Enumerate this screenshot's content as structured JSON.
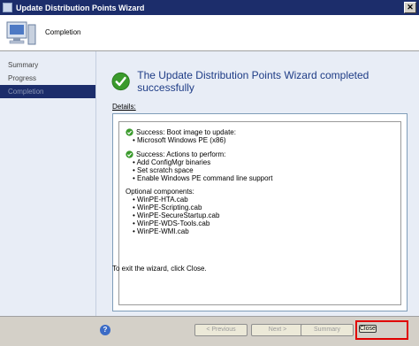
{
  "window": {
    "title": "Update Distribution Points Wizard",
    "close_glyph": "✕"
  },
  "header": {
    "title": "Completion",
    "icon": "computer-icon"
  },
  "sidebar": {
    "items": [
      {
        "label": "Summary"
      },
      {
        "label": "Progress"
      },
      {
        "label": "Completion",
        "active": true
      }
    ]
  },
  "main": {
    "success_message": "The Update Distribution Points Wizard completed successfully",
    "details_label": "Details:",
    "details": {
      "section1": {
        "heading": "Success: Boot image to update:",
        "items": [
          "Microsoft Windows PE (x86)"
        ]
      },
      "section2": {
        "heading": "Success: Actions to perform:",
        "items": [
          "Add ConfigMgr binaries",
          "Set scratch space",
          "Enable Windows PE command line support"
        ]
      },
      "section3": {
        "heading": "Optional components:",
        "items": [
          "WinPE-HTA.cab",
          "WinPE-Scripting.cab",
          "WinPE-SecureStartup.cab",
          "WinPE-WDS-Tools.cab",
          "WinPE-WMI.cab"
        ]
      }
    },
    "exit_message": "To exit the wizard, click Close."
  },
  "footer": {
    "help_glyph": "?",
    "previous_label": "< Previous",
    "next_label": "Next >",
    "summary_label": "Summary",
    "close_label": "Close"
  },
  "colors": {
    "titlebar": "#1c2d6b",
    "accent_text": "#1e3c86",
    "check_green": "#3a9a2c",
    "highlight_red": "#e00000"
  }
}
